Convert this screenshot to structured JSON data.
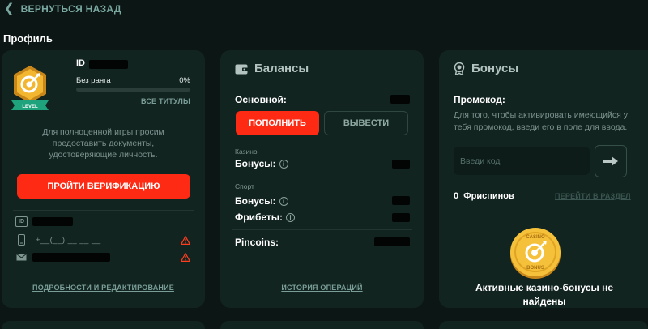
{
  "nav": {
    "back_label": "ВЕРНУТЬСЯ НАЗАД"
  },
  "page": {
    "title": "Профиль"
  },
  "profile": {
    "id_label": "ID",
    "badge_text": "LEVEL",
    "rank_label": "Без ранга",
    "progress_text": "0%",
    "progress_value": 0,
    "all_titles_link": "ВСЕ ТИТУЛЫ",
    "docs_message": "Для полноценной игры просим предоставить документы, удостоверяющие личность.",
    "verify_button": "ПРОЙТИ ВЕРИФИКАЦИЮ",
    "id_icon_text": "ID",
    "phone_placeholder": "+__(__) __ __ __",
    "details_link": "ПОДРОБНОСТИ И РЕДАКТИРОВАНИЕ"
  },
  "balances": {
    "title": "Балансы",
    "main_label": "Основной:",
    "deposit_button": "ПОПОЛНИТЬ",
    "withdraw_button": "ВЫВЕСТИ",
    "casino_section": "Казино",
    "casino_bonuses_label": "Бонусы:",
    "sport_section": "Спорт",
    "sport_bonuses_label": "Бонусы:",
    "freebets_label": "Фрибеты:",
    "info_glyph": "i",
    "pincoins_label": "Pincoins:",
    "history_link": "ИСТОРИЯ ОПЕРАЦИЙ"
  },
  "bonuses": {
    "title": "Бонусы",
    "promo_label": "Промокод:",
    "promo_description": "Для того, чтобы активировать имеющийся у тебя промокод, введи его в поле для ввода.",
    "promo_placeholder": "Введи код",
    "freespins_count": "0",
    "freespins_label": "Фриспинов",
    "goto_section_link": "ПЕРЕЙТИ В РАЗДЕЛ",
    "coin_top_text": "CASINO",
    "coin_bottom_text": "BONUS",
    "no_bonuses_text": "Активные казино-бонусы не найдены"
  },
  "colors": {
    "background": "#0c1715",
    "card": "#122420",
    "accent_red": "#ff2a14",
    "muted_teal": "#7aa8a1"
  }
}
